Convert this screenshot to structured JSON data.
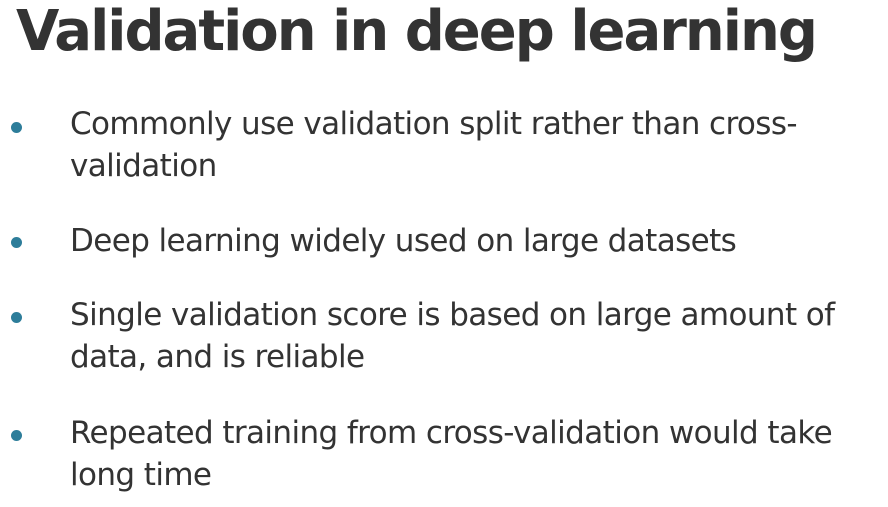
{
  "slide": {
    "title": "Validation in deep learning",
    "bullets": [
      {
        "lines": [
          "Commonly use validation split rather than cross-",
          "validation"
        ]
      },
      {
        "lines": [
          "Deep learning widely used on large datasets"
        ]
      },
      {
        "lines": [
          "Single validation score is based on large amount of",
          "data, and is reliable"
        ]
      },
      {
        "lines": [
          "Repeated training from cross-validation would take",
          "long time"
        ]
      }
    ],
    "colors": {
      "text": "#333333",
      "bullet": "#2d7d9a",
      "background": "#ffffff"
    }
  }
}
